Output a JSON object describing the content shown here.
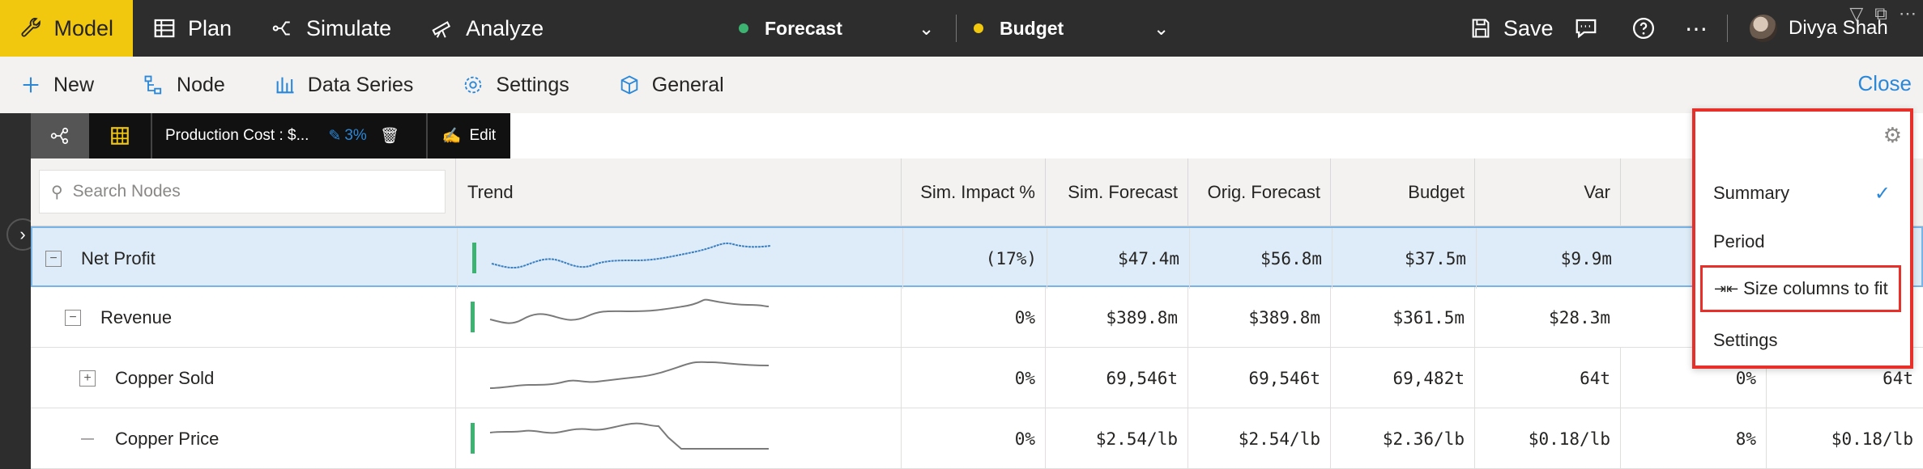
{
  "topbar": {
    "tabs": [
      {
        "label": "Model",
        "icon": "wrench-icon",
        "active": true
      },
      {
        "label": "Plan",
        "icon": "table-icon",
        "active": false
      },
      {
        "label": "Simulate",
        "icon": "branch-icon",
        "active": false
      },
      {
        "label": "Analyze",
        "icon": "telescope-icon",
        "active": false
      }
    ],
    "scenario_primary": {
      "label": "Forecast",
      "color": "#3cb371"
    },
    "scenario_compare": {
      "label": "Budget",
      "color": "#f2c80f"
    },
    "save_label": "Save",
    "user_name": "Divya Shah"
  },
  "subbar": {
    "items": [
      {
        "label": "New",
        "icon": "plus-icon"
      },
      {
        "label": "Node",
        "icon": "node-tree-icon"
      },
      {
        "label": "Data Series",
        "icon": "bar-chart-icon"
      },
      {
        "label": "Settings",
        "icon": "gear-icon"
      },
      {
        "label": "General",
        "icon": "cube-icon"
      }
    ],
    "close_label": "Close"
  },
  "toolstrip": {
    "node_label": "Production Cost : $...",
    "pct_label": "3%",
    "edit_label": "Edit"
  },
  "grid": {
    "search_placeholder": "Search Nodes",
    "headers": {
      "trend": "Trend",
      "sim_impact": "Sim. Impact %",
      "sim_forecast": "Sim. Forecast",
      "orig_forecast": "Orig. Forecast",
      "budget": "Budget",
      "var": "Var"
    },
    "rows": [
      {
        "name": "Net Profit",
        "expander": "minus",
        "sim_impact": "(17%)",
        "sim_forecast": "$47.4m",
        "orig_forecast": "$56.8m",
        "budget": "$37.5m",
        "var": "$9.9m",
        "var_pct": "",
        "extra": "",
        "selected": true,
        "green": true
      },
      {
        "name": "Revenue",
        "expander": "minus",
        "sim_impact": "0%",
        "sim_forecast": "$389.8m",
        "orig_forecast": "$389.8m",
        "budget": "$361.5m",
        "var": "$28.3m",
        "var_pct": "",
        "extra": "",
        "selected": false,
        "green": true
      },
      {
        "name": "Copper Sold",
        "expander": "plus",
        "sim_impact": "0%",
        "sim_forecast": "69,546t",
        "orig_forecast": "69,546t",
        "budget": "69,482t",
        "var": "64t",
        "var_pct": "0%",
        "extra": "64t",
        "selected": false,
        "green": false
      },
      {
        "name": "Copper Price",
        "expander": "dash",
        "sim_impact": "0%",
        "sim_forecast": "$2.54/lb",
        "orig_forecast": "$2.54/lb",
        "budget": "$2.36/lb",
        "var": "$0.18/lb",
        "var_pct": "8%",
        "extra": "$0.18/lb",
        "selected": false,
        "green": true
      }
    ]
  },
  "column_menu": {
    "items": [
      {
        "label": "Summary",
        "checked": true
      },
      {
        "label": "Period",
        "checked": false
      },
      {
        "label": "Size columns to fit",
        "checked": false,
        "highlight": true
      },
      {
        "label": "Settings",
        "checked": false
      }
    ]
  }
}
